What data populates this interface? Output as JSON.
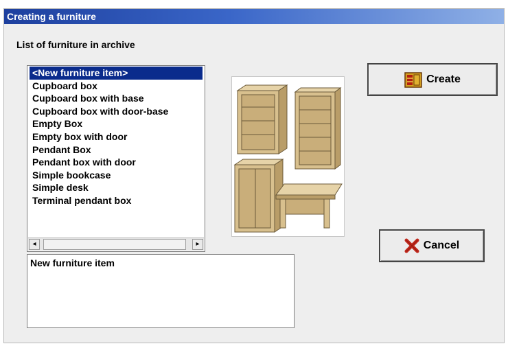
{
  "window": {
    "title": "Creating a furniture"
  },
  "list_label": "List of furniture in archive",
  "furniture_list": {
    "items": [
      "<New furniture item>",
      "Cupboard box",
      "Cupboard box with base",
      "Cupboard box with door-base",
      "Empty Box",
      "Empty box with door",
      "Pendant Box",
      "Pendant box with door",
      "Simple bookcase",
      "Simple desk",
      "Terminal pendant box"
    ],
    "selected_index": 0
  },
  "description": "New furniture item",
  "buttons": {
    "create_label": "Create",
    "create_icon": "furniture-icon",
    "cancel_label": "Cancel",
    "cancel_icon": "red-x-icon"
  },
  "colors": {
    "title_bar": "#1d3f9e",
    "selection": "#0a2b8c",
    "wood": "#d8c08e",
    "cancel_x": "#c0281c"
  }
}
